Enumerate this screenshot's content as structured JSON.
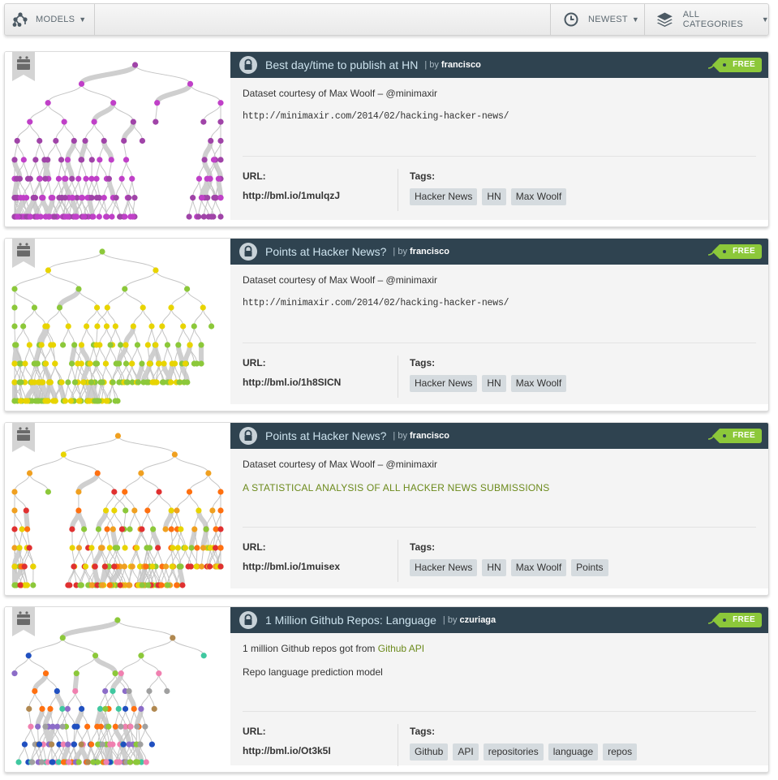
{
  "toolbar": {
    "models_label": "MODELS",
    "newest_label": "NEWEST",
    "categories_label": "ALL CATEGORIES"
  },
  "cards": [
    {
      "title": "Best day/time to publish at HN",
      "by_prefix": "| by",
      "author": "francisco",
      "price": "FREE",
      "desc1": "Dataset courtesy of Max Woolf – @minimaxir",
      "desc2": "http://minimaxir.com/2014/02/hacking-hacker-news/",
      "url_label": "URL:",
      "url": "http://bml.io/1mulqzJ",
      "tags_label": "Tags:",
      "tags": [
        "Hacker News",
        "HN",
        "Max Woolf"
      ]
    },
    {
      "title": "Points at Hacker News?",
      "by_prefix": "| by",
      "author": "francisco",
      "price": "FREE",
      "desc1": "Dataset courtesy of Max Woolf – @minimaxir",
      "desc2": "http://minimaxir.com/2014/02/hacking-hacker-news/",
      "url_label": "URL:",
      "url": "http://bml.io/1h8SICN",
      "tags_label": "Tags:",
      "tags": [
        "Hacker News",
        "HN",
        "Max Woolf"
      ]
    },
    {
      "title": "Points at Hacker News?",
      "by_prefix": "| by",
      "author": "francisco",
      "price": "FREE",
      "desc1": "Dataset courtesy of Max Woolf – @minimaxir",
      "desc2": "A STATISTICAL ANALYSIS OF ALL HACKER NEWS SUBMISSIONS",
      "url_label": "URL:",
      "url": "http://bml.io/1muisex",
      "tags_label": "Tags:",
      "tags": [
        "Hacker News",
        "HN",
        "Max Woolf",
        "Points"
      ]
    },
    {
      "title": "1 Million Github Repos: Language",
      "by_prefix": "| by",
      "author": "czuriaga",
      "price": "FREE",
      "desc1_prefix": "1 million Github repos got from",
      "desc1_link": "Github API",
      "desc2": "Repo language prediction model",
      "url_label": "URL:",
      "url": "http://bml.io/Ot3k5I",
      "tags_label": "Tags:",
      "tags": [
        "Github",
        "API",
        "repositories",
        "language",
        "repos"
      ]
    }
  ],
  "icons": {
    "models": "model-tree-icon",
    "newest": "clock-icon",
    "categories": "layers-icon",
    "card_type": "model-type-icon",
    "private": "lock-icon",
    "price": "price-tag-icon"
  },
  "colors": {
    "header_bg": "#2f4350",
    "title": "#cde3ee",
    "free_tag": "#8cc83a",
    "tag_chip": "#d5dbdf",
    "link": "#6c8a1c",
    "tree_palettes": [
      [
        "#a044a8",
        "#c040c8"
      ],
      [
        "#e8d400",
        "#8cc83a"
      ],
      [
        "#e8d400",
        "#f0a020",
        "#e03030",
        "#ff7010",
        "#8cc83a"
      ],
      [
        "#40c8a0",
        "#8c6cc8",
        "#f080b0",
        "#ff7010",
        "#b08850",
        "#8cc83a",
        "#2050c0",
        "#a0a0a0"
      ]
    ]
  }
}
